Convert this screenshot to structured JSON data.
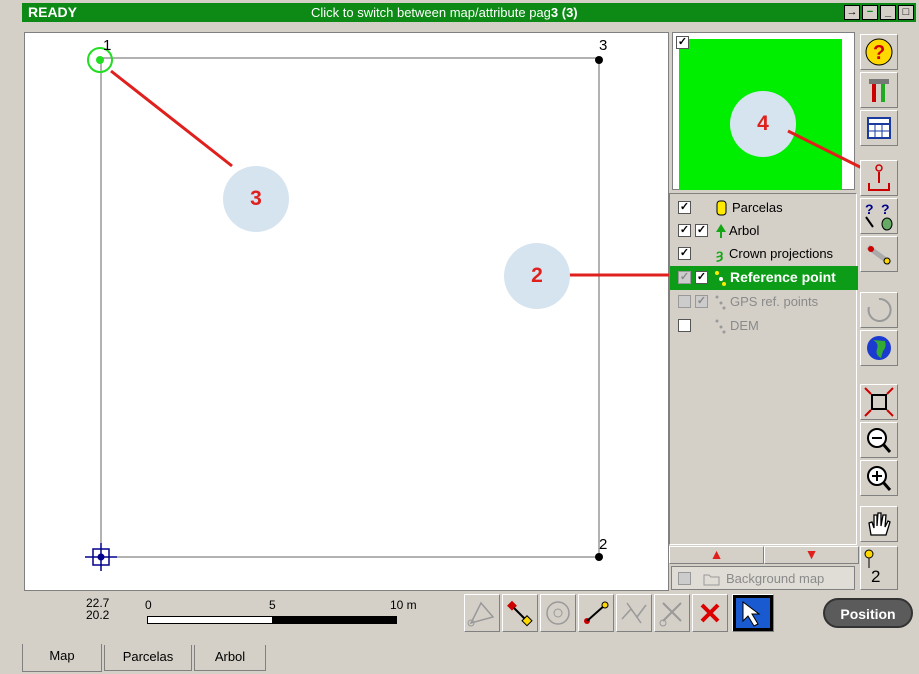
{
  "titlebar": {
    "status": "READY",
    "message": "Click to switch between map/attribute pag",
    "message_bold": "3 (3)",
    "buttons": [
      "→",
      "−",
      "_",
      "□"
    ]
  },
  "map": {
    "points": [
      "1",
      "3",
      "2"
    ],
    "callouts": [
      "3",
      "4",
      "2"
    ]
  },
  "layers": [
    {
      "label": "Parcelas",
      "checked": true
    },
    {
      "label": "Arbol",
      "checked": true
    },
    {
      "label": "Crown projections",
      "checked": true
    },
    {
      "label": "Reference point",
      "checked": true,
      "selected": true
    },
    {
      "label": "GPS ref. points",
      "checked": false,
      "disabled": true
    },
    {
      "label": "DEM",
      "checked": false,
      "disabled": true
    }
  ],
  "background_map": "Background map",
  "toolbar": {
    "selected_count": "2"
  },
  "scale": {
    "coord_top": "22.7",
    "coord_bottom": "20.2",
    "tick_0": "0",
    "tick_5": "5",
    "tick_10": "10 m"
  },
  "position_button": "Position",
  "tabs": [
    "Map",
    "Parcelas",
    "Arbol"
  ],
  "colors": {
    "accent_green": "#0c8a15",
    "callout_red": "#e0201c",
    "overview_green": "#00ee00"
  }
}
